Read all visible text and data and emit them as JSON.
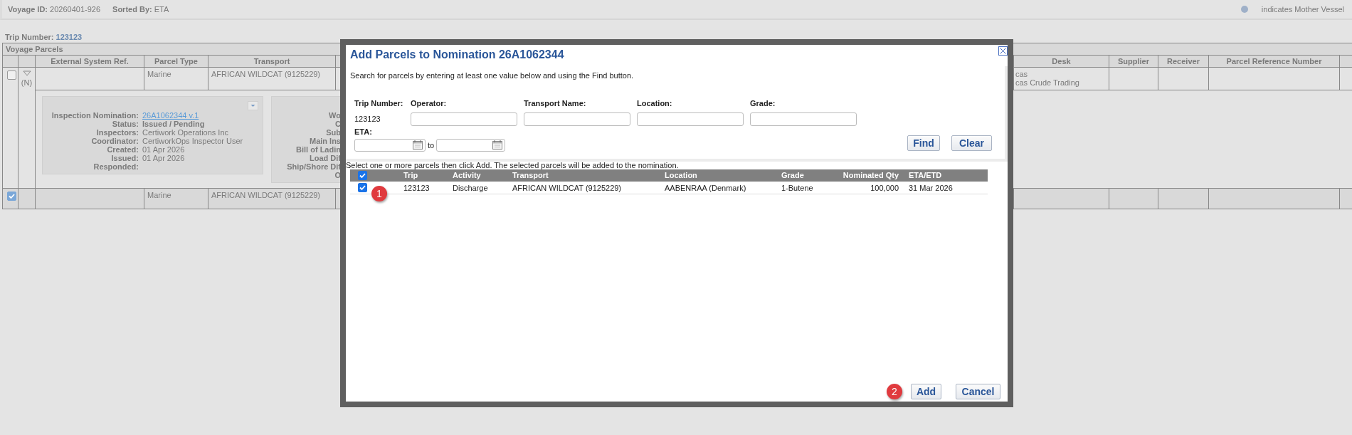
{
  "header": {
    "voyage_id_label": "Voyage ID:",
    "voyage_id": "20260401-926",
    "sorted_by_label": "Sorted By:",
    "sorted_by": "ETA",
    "legend": "indicates Mother Vessel"
  },
  "trip": {
    "label": "Trip Number:",
    "value": "123123"
  },
  "parcels": {
    "title": "Voyage Parcels",
    "columns": [
      "External System Ref.",
      "Parcel Type",
      "Transport",
      "Desk",
      "Supplier",
      "Receiver",
      "Parcel Reference Number"
    ],
    "rows": [
      {
        "checked": false,
        "expander": {
          "expanded": true,
          "flag": "(N)"
        },
        "parcel_type": "Marine",
        "transport": "AFRICAN WILDCAT (9125229)",
        "desk": [
          "cas",
          "cas Crude Trading"
        ]
      },
      {
        "checked": true,
        "parcel_type": "Marine",
        "transport": "AFRICAN WILDCAT (9125229)"
      }
    ],
    "detail": {
      "nomination": [
        {
          "label": "Inspection Nomination:",
          "value": "26A1062344 v.1",
          "kind": "link"
        },
        {
          "label": "Status:",
          "value": "Issued / Pending",
          "kind": "bold"
        },
        {
          "label": "Inspectors:",
          "value": "Certiwork Operations Inc",
          "kind": "plain"
        },
        {
          "label": "Coordinator:",
          "value": "CertiworkOps Inspector User",
          "kind": "plain"
        },
        {
          "label": "Created:",
          "value": "01 Apr 2026",
          "kind": "plain"
        },
        {
          "label": "Issued:",
          "value": "01 Apr 2026",
          "kind": "plain"
        },
        {
          "label": "Responded:"
        }
      ],
      "side_labels": [
        "Wo",
        "C",
        "Sub",
        "Main Ins",
        "Bill of Ladin",
        "Load Dif",
        "Ship/Shore Dif",
        "O"
      ]
    }
  },
  "dialog": {
    "title": "Add Parcels to Nomination 26A1062344",
    "intro": "Search for parcels by entering at least one value below and using the Find button.",
    "fields": [
      {
        "label": "Trip Number:",
        "kind": "text",
        "value": "123123"
      },
      {
        "label": "Operator:",
        "kind": "input"
      },
      {
        "label": "Transport Name:",
        "kind": "input"
      },
      {
        "label": "Location:",
        "kind": "input"
      },
      {
        "label": "Grade:",
        "kind": "input"
      }
    ],
    "eta": {
      "label": "ETA:",
      "separator": "to"
    },
    "search_buttons": [
      "Find",
      "Clear"
    ],
    "instruction": "Select one or more parcels then click Add. The selected parcels will be added to the nomination.",
    "table": {
      "all_checked": true,
      "columns": [
        "Trip",
        "Activity",
        "Transport",
        "Location",
        "Grade",
        "Nominated Qty",
        "ETA/ETD"
      ],
      "rows": [
        {
          "checked": true,
          "badge": "1",
          "cells": [
            "123123",
            "Discharge",
            "AFRICAN WILDCAT (9125229)",
            "AABENRAA (Denmark)",
            "1-Butene",
            "100,000",
            "31 Mar 2026"
          ]
        }
      ]
    },
    "footer": {
      "badge": "2",
      "buttons": [
        "Add",
        "Cancel"
      ]
    }
  }
}
